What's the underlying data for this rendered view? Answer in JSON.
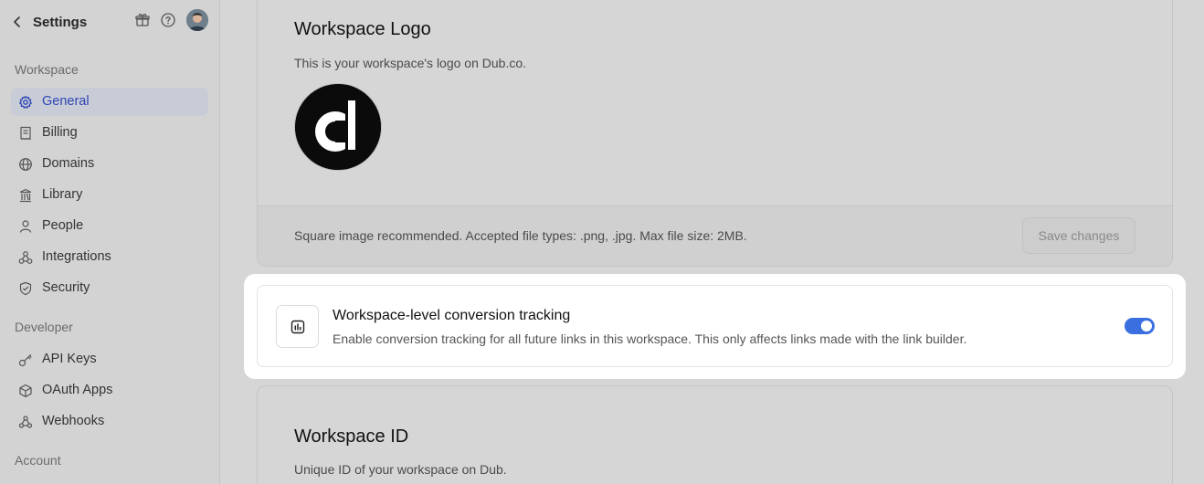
{
  "sidebar": {
    "back_label": "Settings",
    "header_icons": [
      "gift-icon",
      "help-icon"
    ],
    "sections": {
      "workspace": "Workspace",
      "developer": "Developer",
      "account": "Account"
    },
    "workspace_items": [
      {
        "label": "General",
        "icon": "gear-icon",
        "active": true
      },
      {
        "label": "Billing",
        "icon": "receipt-icon"
      },
      {
        "label": "Domains",
        "icon": "globe-icon"
      },
      {
        "label": "Library",
        "icon": "library-icon"
      },
      {
        "label": "People",
        "icon": "user-icon"
      },
      {
        "label": "Integrations",
        "icon": "integrations-icon"
      },
      {
        "label": "Security",
        "icon": "shield-icon"
      }
    ],
    "developer_items": [
      {
        "label": "API Keys",
        "icon": "key-icon"
      },
      {
        "label": "OAuth Apps",
        "icon": "cube-icon"
      },
      {
        "label": "Webhooks",
        "icon": "webhook-icon"
      }
    ]
  },
  "logo_card": {
    "title": "Workspace Logo",
    "description": "This is your workspace's logo on Dub.co.",
    "footer_note": "Square image recommended. Accepted file types: .png, .jpg. Max file size: 2MB.",
    "save_label": "Save changes"
  },
  "conversion": {
    "title": "Workspace-level conversion tracking",
    "description": "Enable conversion tracking for all future links in this workspace. This only affects links made with the link builder.",
    "enabled": true,
    "accent": "#3b6fe0"
  },
  "id_card": {
    "title": "Workspace ID",
    "description": "Unique ID of your workspace on Dub."
  }
}
